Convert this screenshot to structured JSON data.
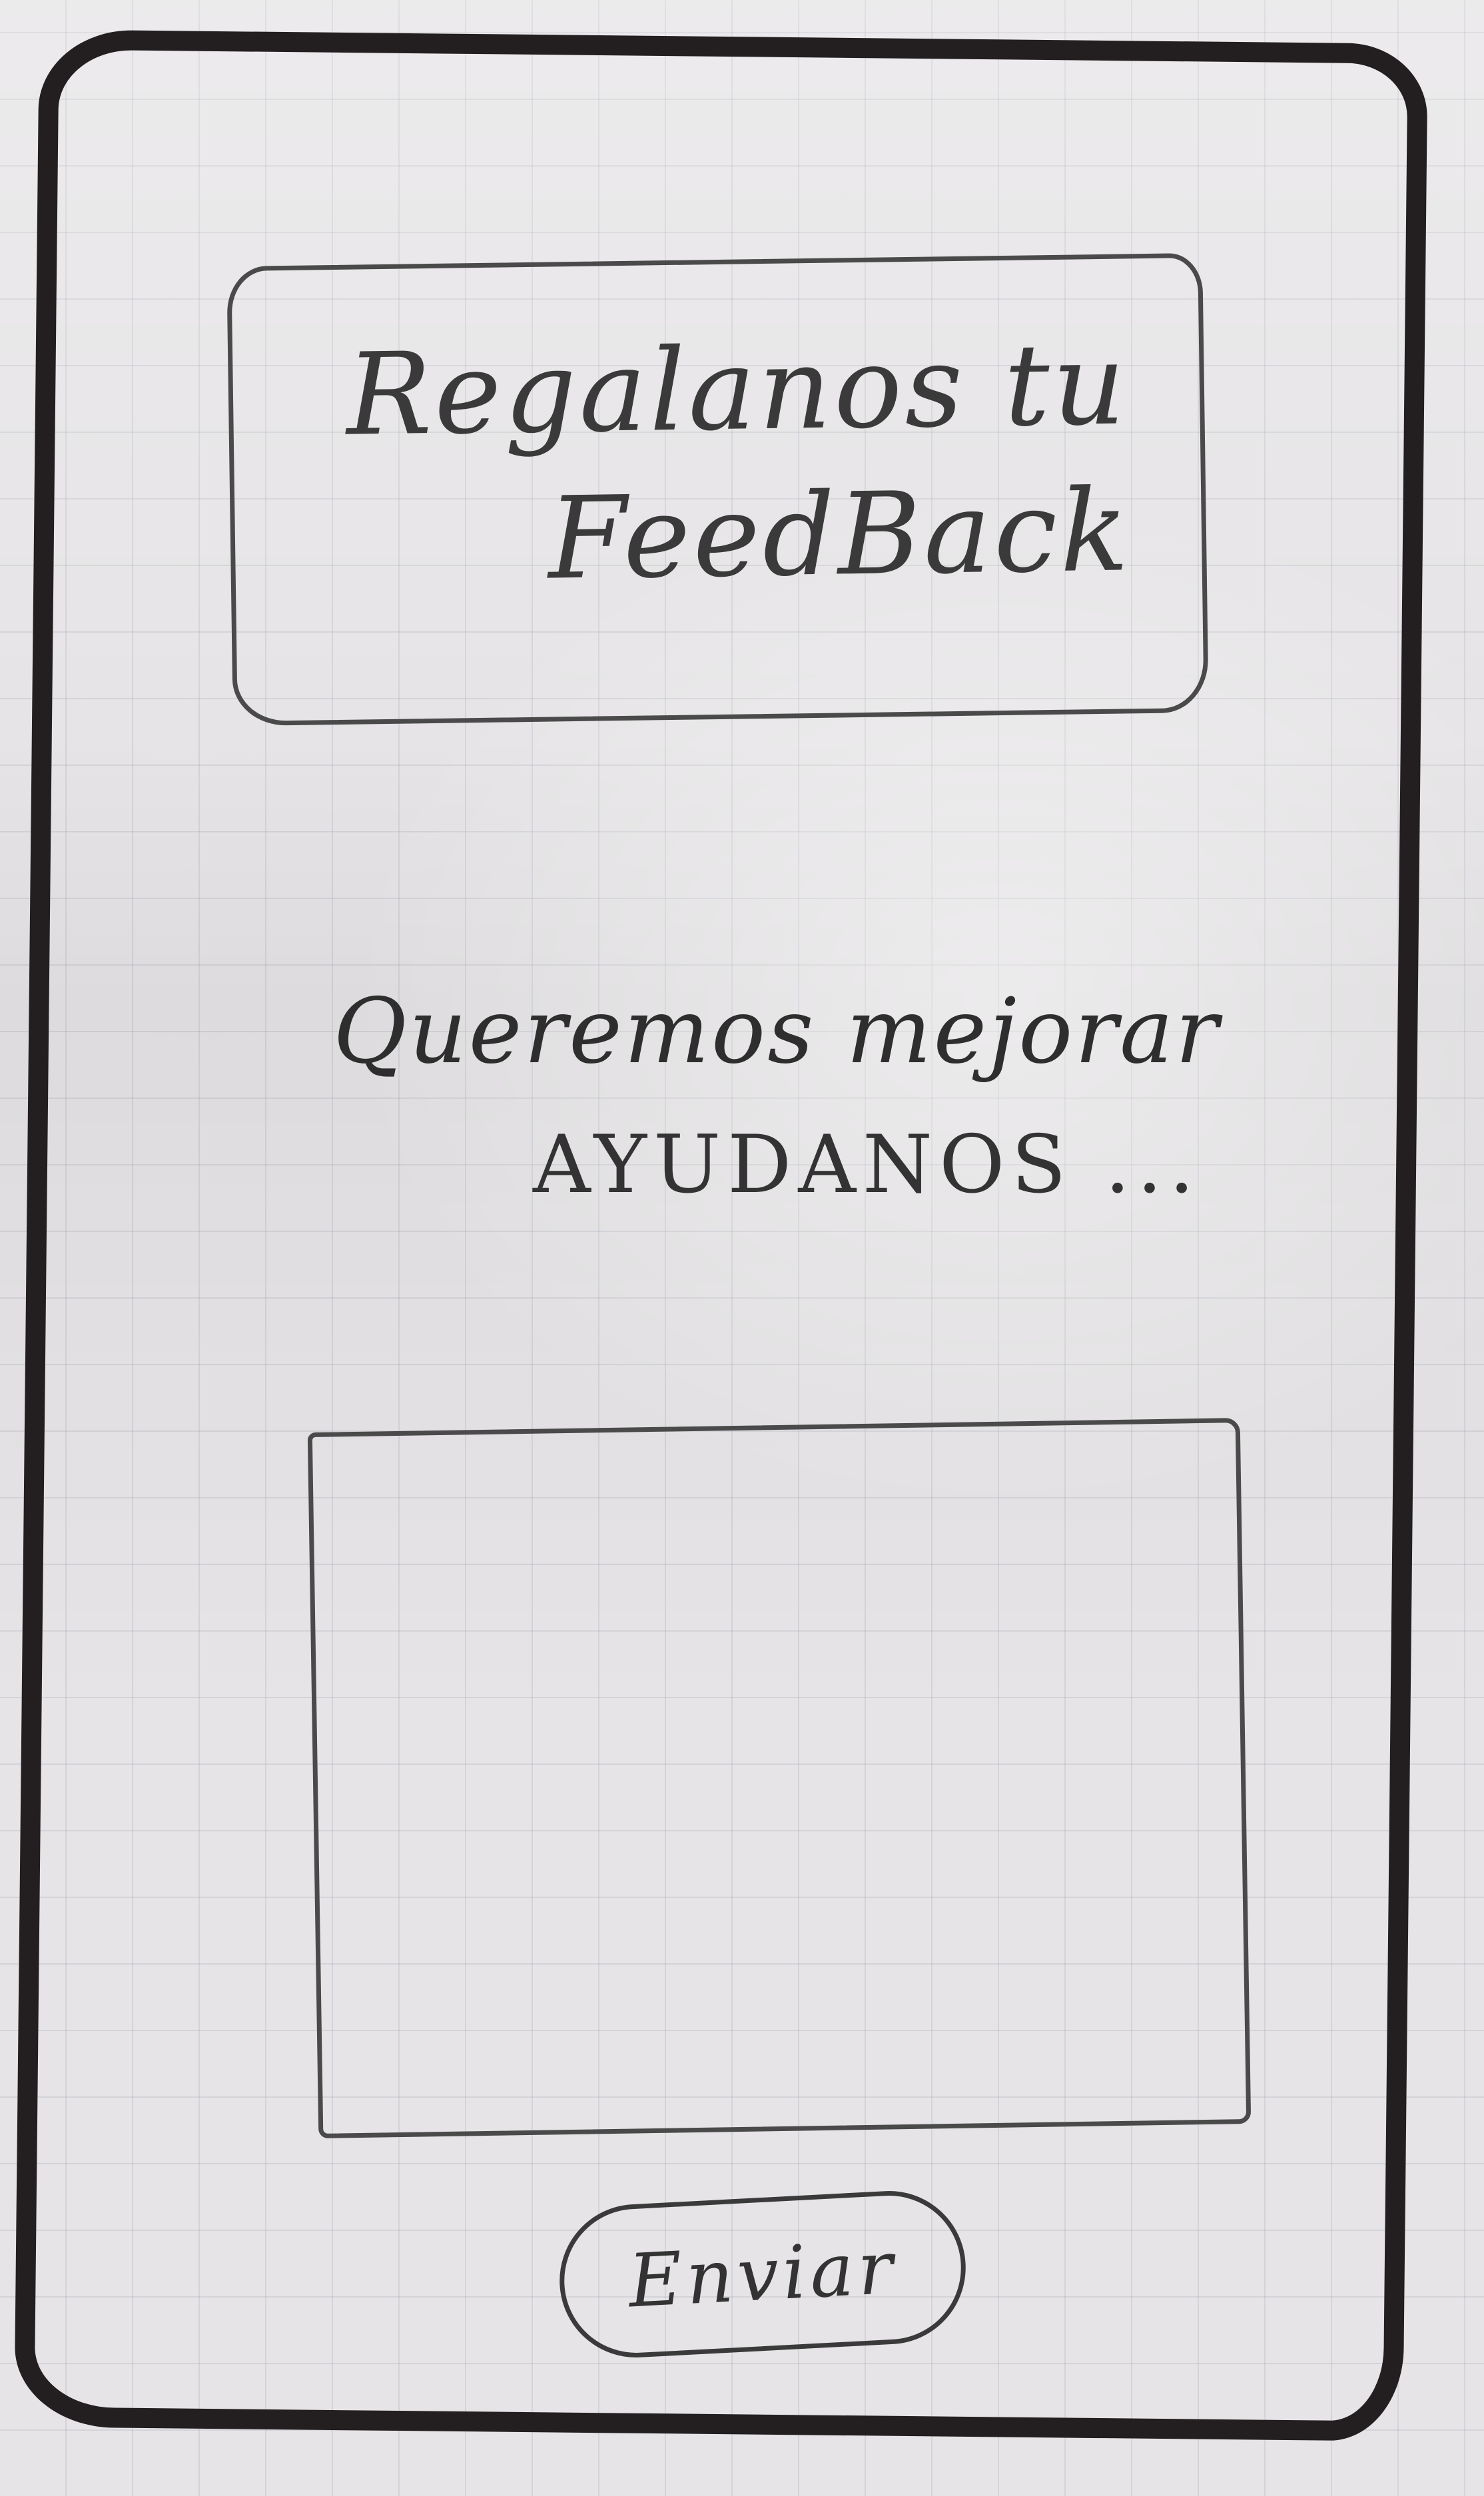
{
  "header": {
    "title_line_1": "Regalanos tu",
    "title_line_2": "FeedBack"
  },
  "main": {
    "message_line_1": "Queremos mejorar",
    "message_line_2": "AYUDANOS ...",
    "feedback_input": {
      "value": "",
      "placeholder": ""
    }
  },
  "actions": {
    "send_label": "Enviar"
  }
}
